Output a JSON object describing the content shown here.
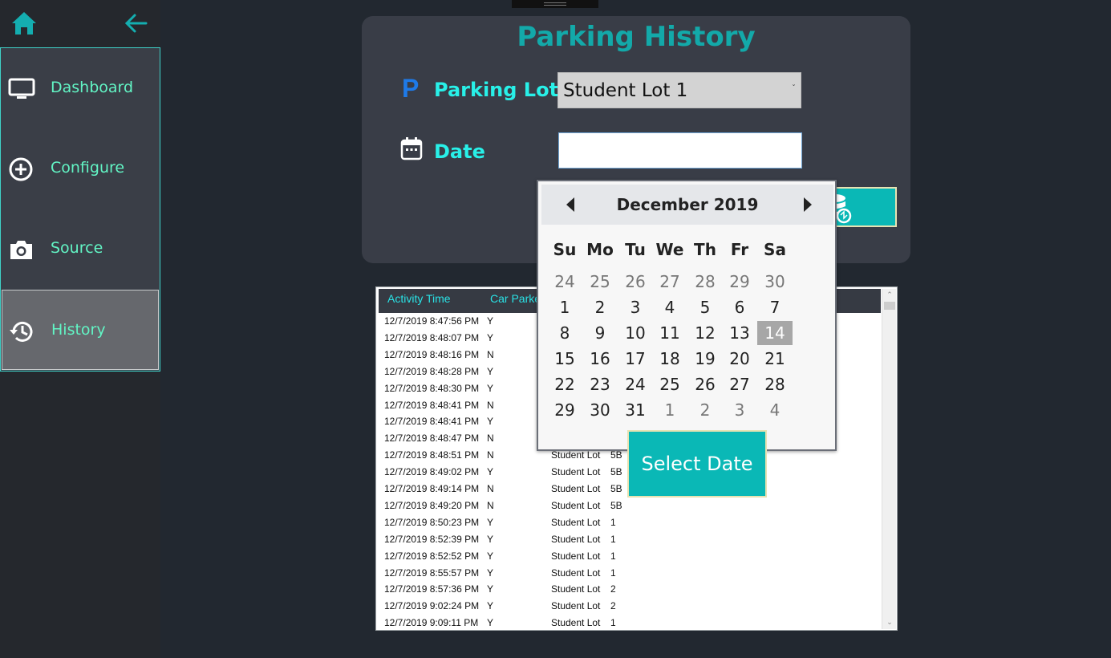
{
  "sidebar": {
    "items": [
      {
        "label": "Dashboard",
        "icon": "monitor-icon"
      },
      {
        "label": "Configure",
        "icon": "plus-circle-icon"
      },
      {
        "label": "Source",
        "icon": "camera-icon"
      },
      {
        "label": "History",
        "icon": "history-icon",
        "active": true
      }
    ]
  },
  "panel": {
    "title": "Parking History",
    "parking_lot_label": "Parking Lot",
    "parking_lot_icon_text": "P",
    "parking_lot_value": "Student Lot 1",
    "date_label": "Date",
    "date_value": ""
  },
  "grid": {
    "columns": [
      "Activity Time",
      "Car Parke"
    ],
    "rows": [
      [
        "12/7/2019 8:47:56 PM",
        "Y",
        "",
        ""
      ],
      [
        "12/7/2019 8:48:07 PM",
        "Y",
        "",
        ""
      ],
      [
        "12/7/2019 8:48:16 PM",
        "N",
        "",
        ""
      ],
      [
        "12/7/2019 8:48:28 PM",
        "Y",
        "",
        ""
      ],
      [
        "12/7/2019 8:48:30 PM",
        "Y",
        "",
        ""
      ],
      [
        "12/7/2019 8:48:41 PM",
        "N",
        "",
        ""
      ],
      [
        "12/7/2019 8:48:41 PM",
        "Y",
        "",
        ""
      ],
      [
        "12/7/2019 8:48:47 PM",
        "N",
        "",
        ""
      ],
      [
        "12/7/2019 8:48:51 PM",
        "N",
        "Student Lot",
        "5B"
      ],
      [
        "12/7/2019 8:49:02 PM",
        "Y",
        "Student Lot",
        "5B"
      ],
      [
        "12/7/2019 8:49:14 PM",
        "N",
        "Student Lot",
        "5B"
      ],
      [
        "12/7/2019 8:49:20 PM",
        "N",
        "Student Lot",
        "5B"
      ],
      [
        "12/7/2019 8:50:23 PM",
        "Y",
        "Student Lot",
        "1"
      ],
      [
        "12/7/2019 8:52:39 PM",
        "Y",
        "Student Lot",
        "1"
      ],
      [
        "12/7/2019 8:52:52 PM",
        "Y",
        "Student Lot",
        "1"
      ],
      [
        "12/7/2019 8:55:57 PM",
        "Y",
        "Student Lot",
        "1"
      ],
      [
        "12/7/2019 8:57:36 PM",
        "Y",
        "Student Lot",
        "2"
      ],
      [
        "12/7/2019 9:02:24 PM",
        "Y",
        "Student Lot",
        "2"
      ],
      [
        "12/7/2019 9:09:11 PM",
        "Y",
        "Student Lot",
        "1"
      ]
    ]
  },
  "calendar": {
    "month_label": "December 2019",
    "weekdays": [
      "Su",
      "Mo",
      "Tu",
      "We",
      "Th",
      "Fr",
      "Sa"
    ],
    "weeks": [
      [
        "24",
        "25",
        "26",
        "27",
        "28",
        "29",
        "30"
      ],
      [
        "1",
        "2",
        "3",
        "4",
        "5",
        "6",
        "7"
      ],
      [
        "8",
        "9",
        "10",
        "11",
        "12",
        "13",
        "14"
      ],
      [
        "15",
        "16",
        "17",
        "18",
        "19",
        "20",
        "21"
      ],
      [
        "22",
        "23",
        "24",
        "25",
        "26",
        "27",
        "28"
      ],
      [
        "29",
        "30",
        "31",
        "1",
        "2",
        "3",
        "4"
      ]
    ],
    "selected_day": "14",
    "select_button": "Select Date"
  },
  "colors": {
    "accent": "#0ab8b6",
    "label": "#28f0e8",
    "title": "#13a9a9",
    "nav_text": "#62f5c5",
    "parking_icon": "#1e7ae8"
  }
}
